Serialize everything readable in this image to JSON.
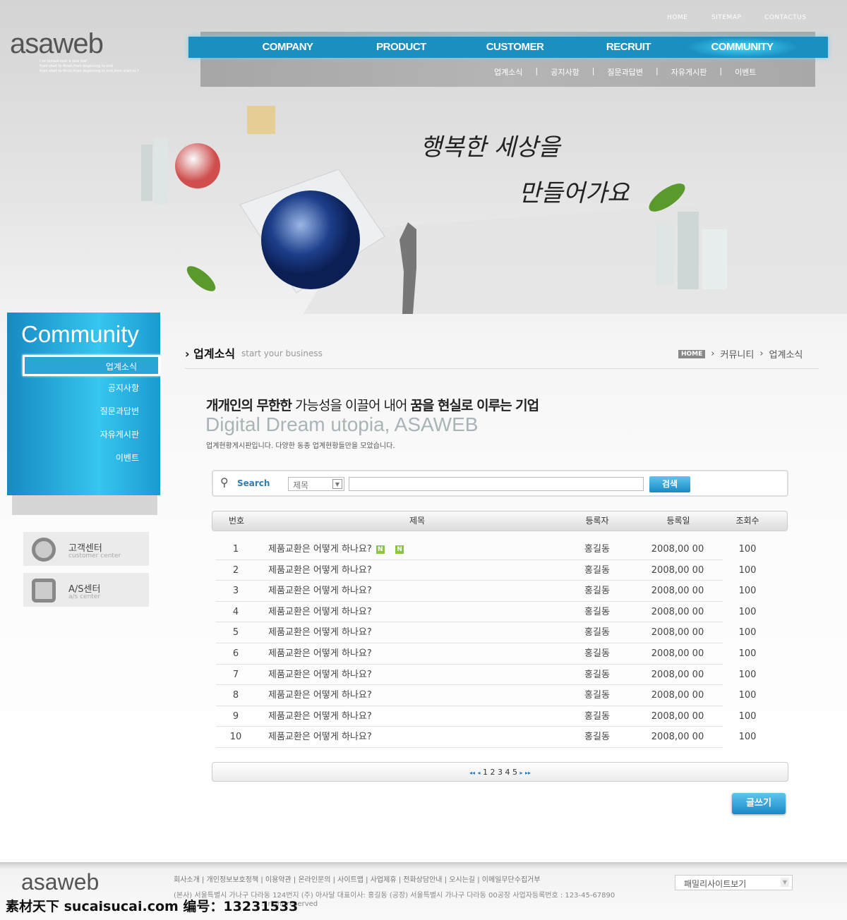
{
  "header": {
    "logo": "asaweb",
    "logo_tagline": [
      "I've turned over a new leaf",
      "from start to finish,from beginning to end",
      "from start to finish,from beginning to end,from start to f"
    ],
    "utility_links": [
      "HOME",
      "SITEMAP",
      "CONTACTUS"
    ],
    "nav": [
      "COMPANY",
      "PRODUCT",
      "CUSTOMER",
      "RECRUIT",
      "COMMUNITY"
    ],
    "nav_active": "COMMUNITY",
    "subnav": [
      "업계소식",
      "공지사항",
      "질문과답변",
      "자유게시판",
      "이벤트"
    ]
  },
  "hero": {
    "handwriting": [
      "행복한 세상을",
      "만들어가요"
    ]
  },
  "sidebar": {
    "title": "Community",
    "items": [
      "업계소식",
      "공지사항",
      "질문과답변",
      "자유게시판",
      "이벤트"
    ],
    "selected": "업계소식",
    "centers": [
      {
        "title": "고객센터",
        "sub": "customer center",
        "icon": "headset-icon"
      },
      {
        "title": "A/S센터",
        "sub": "a/s center",
        "icon": "device-icon"
      }
    ]
  },
  "section": {
    "title": "업계소식",
    "subtitle": "start your business",
    "breadcrumb": [
      "HOME",
      "커뮤니티",
      "업계소식"
    ],
    "slogan_parts": [
      "개개인의 무한한",
      "가능성을 이끌어 내어",
      "꿈을 현실로 이루는 기업"
    ],
    "tagline": "Digital Dream utopia, ASAWEB",
    "description": "업계현황게시판입니다. 다양한 동종 업계현황들만을 모았습니다."
  },
  "search": {
    "label": "Search",
    "select_value": "제목",
    "input_value": "",
    "button": "검색"
  },
  "table": {
    "columns": [
      "번호",
      "제목",
      "등록자",
      "등록일",
      "조회수"
    ],
    "rows": [
      {
        "no": "1",
        "title": "제품교환은 어떻게 하나요?",
        "new": "N",
        "author": "홍길동",
        "date": "2008,00 00",
        "views": "100"
      },
      {
        "no": "2",
        "title": "제품교환은 어떻게 하나요?",
        "author": "홍길동",
        "date": "2008,00 00",
        "views": "100"
      },
      {
        "no": "3",
        "title": "제품교환은 어떻게 하나요?",
        "author": "홍길동",
        "date": "2008,00 00",
        "views": "100"
      },
      {
        "no": "4",
        "title": "제품교환은 어떻게 하나요?",
        "author": "홍길동",
        "date": "2008,00 00",
        "views": "100"
      },
      {
        "no": "5",
        "title": "제품교환은 어떻게 하나요?",
        "author": "홍길동",
        "date": "2008,00 00",
        "views": "100"
      },
      {
        "no": "6",
        "title": "제품교환은 어떻게 하나요?",
        "author": "홍길동",
        "date": "2008,00 00",
        "views": "100"
      },
      {
        "no": "7",
        "title": "제품교환은 어떻게 하나요?",
        "author": "홍길동",
        "date": "2008,00 00",
        "views": "100"
      },
      {
        "no": "8",
        "title": "제품교환은 어떻게 하나요?",
        "author": "홍길동",
        "date": "2008,00 00",
        "views": "100"
      },
      {
        "no": "9",
        "title": "제품교환은 어떻게 하나요?",
        "author": "홍길동",
        "date": "2008,00 00",
        "views": "100"
      },
      {
        "no": "10",
        "title": "제품교환은 어떻게 하나요?",
        "author": "홍길동",
        "date": "2008,00 00",
        "views": "100"
      }
    ]
  },
  "pagination": {
    "first": "◂◂",
    "prev": "◂",
    "pages": [
      "1",
      "2",
      "3",
      "4",
      "5"
    ],
    "next": "▸",
    "last": "▸▸"
  },
  "write_button": "글쓰기",
  "footer": {
    "logo": "asaweb",
    "links": [
      "회사소개",
      "개인정보보호정책",
      "이용약관",
      "온라인문의",
      "사이트맵",
      "사업제휴",
      "전화상담안내",
      "오시는길",
      "이메일무단수집거부"
    ],
    "address": "(본사) 서울특별시 가나구 다라동 124번지 (주) 아사달 대표이사: 홍길동 (공장) 서울특별시 가나구 다라동 00공장 사업자등록번호 : 123-45-67890",
    "copyright": "...right reserved",
    "family_site": "패밀리사이트보기"
  },
  "watermark": "素材天下 sucaisucai.com  编号：13231533",
  "colors": {
    "accent": "#1b8fc0",
    "accent_light": "#36c6ef"
  }
}
